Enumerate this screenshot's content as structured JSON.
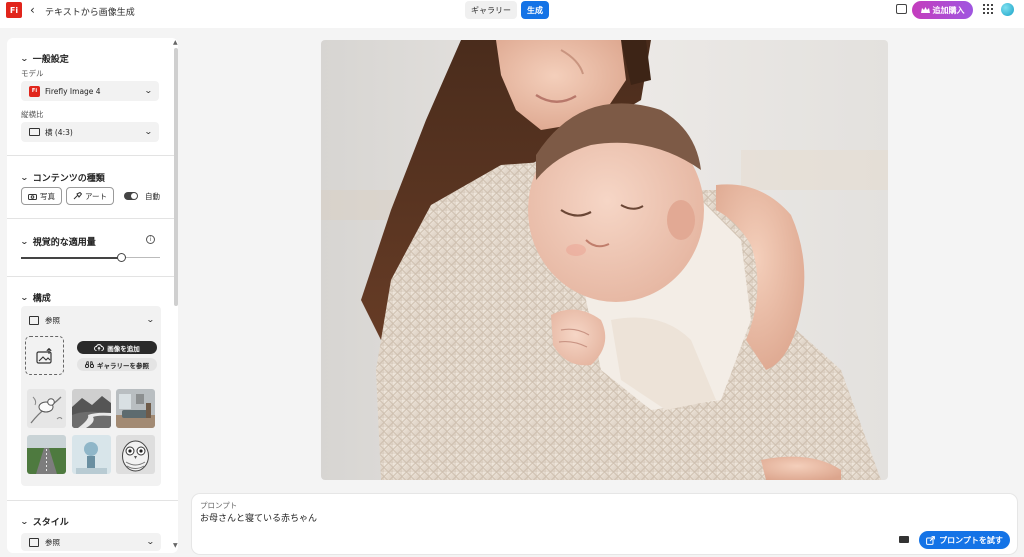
{
  "app": {
    "logo_text": "Fi",
    "back_glyph": "‹",
    "breadcrumb": "テキストから画像生成"
  },
  "tabs": [
    {
      "label": "ギャラリー",
      "active": false
    },
    {
      "label": "生成",
      "active": true
    }
  ],
  "header": {
    "buy_label": "追加購入",
    "buy_icon": "crown-icon",
    "chat_icon": "comment-icon",
    "apps_icon": "app-grid-icon",
    "avatar": "user-avatar"
  },
  "sidebar": {
    "general": {
      "title": "一般設定",
      "model_label": "モデル",
      "model_value": "Firefly Image 4",
      "model_badge": "Fi",
      "ratio_label": "縦横比",
      "ratio_value": "横 (4:3)"
    },
    "content_type": {
      "title": "コンテンツの種類",
      "photo_label": "写真",
      "art_label": "アート",
      "auto_label": "自動",
      "auto_on": true
    },
    "visual_intensity": {
      "title": "視覚的な適用量",
      "info_glyph": "i",
      "level": 0.72
    },
    "composition": {
      "title": "構成",
      "reference_label": "参照",
      "add_image_label": "画像を追加",
      "browse_gallery_label": "ギャラリーを参照",
      "thumbnails": [
        "bird-sketch-thumbnail",
        "river-landscape-thumbnail",
        "living-room-thumbnail",
        "road-field-thumbnail",
        "sphere-sculpture-thumbnail",
        "owl-drawing-thumbnail"
      ]
    },
    "style": {
      "title": "スタイル",
      "reference_label": "参照"
    }
  },
  "main": {
    "image_subject": "mother-holding-sleeping-baby-photo"
  },
  "prompt": {
    "label": "プロンプト",
    "text": "お母さんと寝ている赤ちゃん",
    "try_label": "プロンプトを試す"
  },
  "colors": {
    "accent": "#1473e6",
    "brand_red": "#e1251b",
    "buy_gradient_start": "#c43dbd",
    "buy_gradient_end": "#9f56e0"
  }
}
